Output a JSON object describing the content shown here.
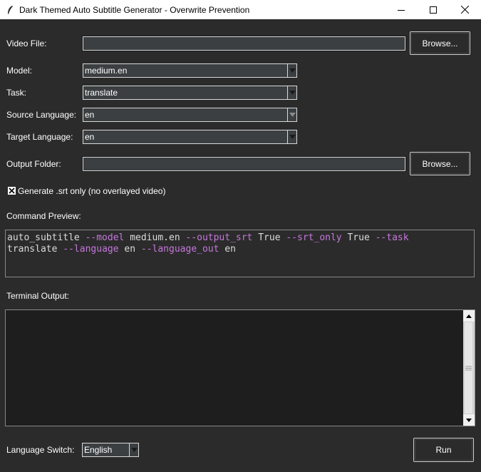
{
  "window": {
    "title": "Dark Themed Auto Subtitle Generator - Overwrite Prevention"
  },
  "form": {
    "video_file_label": "Video File:",
    "video_file_value": "",
    "browse_label": "Browse...",
    "model_label": "Model:",
    "model_value": "medium.en",
    "task_label": "Task:",
    "task_value": "translate",
    "source_language_label": "Source Language:",
    "source_language_value": "en",
    "target_language_label": "Target Language:",
    "target_language_value": "en",
    "output_folder_label": "Output Folder:",
    "output_folder_value": "",
    "output_browse_label": "Browse...",
    "srt_only_label": "Generate .srt only (no overlayed video)",
    "srt_only_checked": true
  },
  "command_preview": {
    "label": "Command Preview:",
    "tokens": [
      {
        "text": "auto_subtitle ",
        "kw": false
      },
      {
        "text": "--model",
        "kw": true
      },
      {
        "text": " medium.en ",
        "kw": false
      },
      {
        "text": "--output_srt",
        "kw": true
      },
      {
        "text": " True ",
        "kw": false
      },
      {
        "text": "--srt_only",
        "kw": true
      },
      {
        "text": " True ",
        "kw": false
      },
      {
        "text": "--task",
        "kw": true
      },
      {
        "text": "\n",
        "kw": false
      },
      {
        "text": "translate ",
        "kw": false
      },
      {
        "text": "--language",
        "kw": true
      },
      {
        "text": " en ",
        "kw": false
      },
      {
        "text": "--language_out",
        "kw": true
      },
      {
        "text": " en",
        "kw": false
      }
    ]
  },
  "terminal": {
    "label": "Terminal Output:",
    "content": ""
  },
  "footer": {
    "language_switch_label": "Language Switch:",
    "language_switch_value": "English",
    "run_label": "Run"
  },
  "colors": {
    "background": "#2b2b2b",
    "entry": "#3c3f41",
    "keyword": "#c678dd",
    "terminal_bg": "#1e1e1e"
  }
}
